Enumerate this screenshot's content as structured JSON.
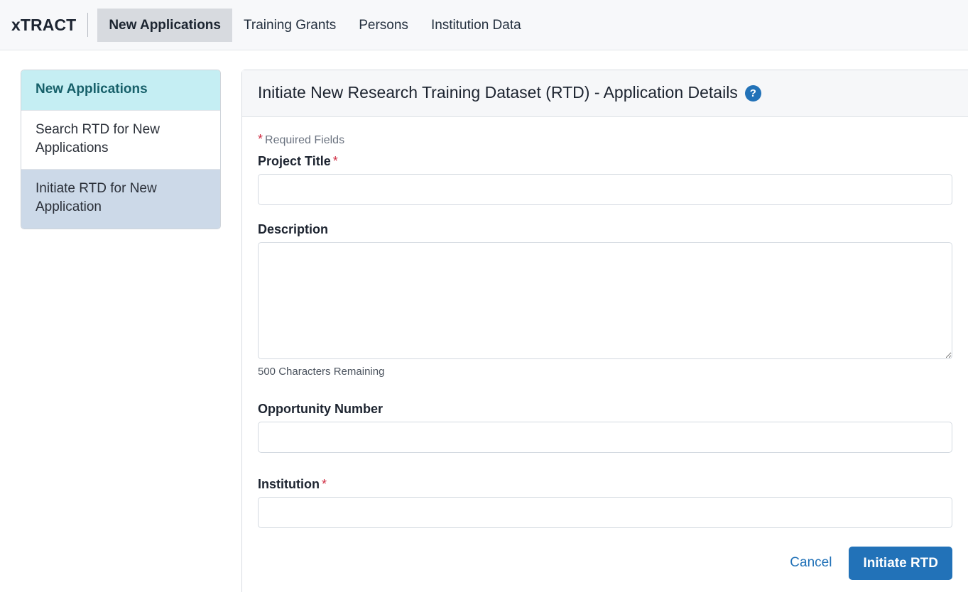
{
  "topnav": {
    "brand": "xTRACT",
    "items": [
      {
        "label": "New Applications",
        "active": true
      },
      {
        "label": "Training Grants",
        "active": false
      },
      {
        "label": "Persons",
        "active": false
      },
      {
        "label": "Institution Data",
        "active": false
      }
    ]
  },
  "sidebar": {
    "header": "New Applications",
    "items": [
      {
        "label": "Search RTD for New Applications",
        "selected": false
      },
      {
        "label": "Initiate RTD for New Application",
        "selected": true
      }
    ]
  },
  "panel": {
    "title": "Initiate New Research Training Dataset (RTD) - Application Details",
    "help_icon": "help-circle-icon",
    "help_glyph": "?",
    "required_note": "Required Fields",
    "required_marker": "*",
    "fields": {
      "project_title": {
        "label": "Project Title",
        "required": true,
        "value": "",
        "placeholder": ""
      },
      "description": {
        "label": "Description",
        "required": false,
        "value": "",
        "placeholder": "",
        "counter": "500 Characters Remaining"
      },
      "opportunity_number": {
        "label": "Opportunity Number",
        "required": false,
        "value": "",
        "placeholder": ""
      },
      "institution": {
        "label": "Institution",
        "required": true,
        "value": "",
        "placeholder": ""
      }
    },
    "actions": {
      "cancel_label": "Cancel",
      "submit_label": "Initiate RTD"
    }
  },
  "colors": {
    "accent_blue": "#2272b8",
    "sidebar_header_bg": "#c5eef3",
    "sidebar_header_text": "#17606a",
    "sidebar_selected_bg": "#ccd9e8",
    "required_asterisk": "#cf2b41",
    "nav_active_bg": "#d7dadf"
  }
}
